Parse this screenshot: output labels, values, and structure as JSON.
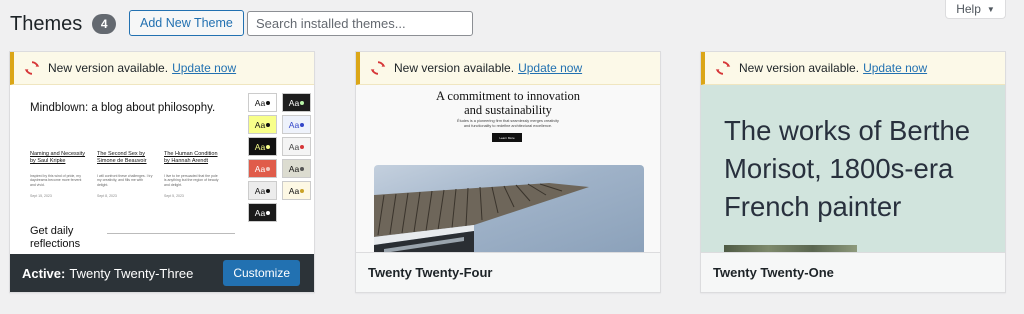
{
  "header": {
    "title": "Themes",
    "count": "4",
    "add_new_label": "Add New Theme",
    "search_placeholder": "Search installed themes...",
    "help_label": "Help",
    "help_caret": "▼"
  },
  "colors": {
    "accent": "#2271b1",
    "notice_border": "#dba617",
    "notice_bg": "#fcf9e8",
    "update_icon": "#d63638",
    "active_footer": "#2c3338"
  },
  "notice": {
    "icon": "update-icon",
    "text": "New version available.",
    "link": "Update now"
  },
  "themes": [
    {
      "name": "Twenty Twenty-Three",
      "active_prefix": "Active:",
      "customize_label": "Customize",
      "preview": {
        "blog_title": "Mindblown: a blog about philosophy.",
        "posts": [
          {
            "title": "Naming and Necessity by Saul Kripke",
            "excerpt": "Inspired by this wind of pride, my daydreams become more fervent and vivid.",
            "date": "Sept 15, 2023"
          },
          {
            "title": "The Second Sex by Simone de Beauvoir",
            "excerpt": "I will confront these challenges. I try my creativity, and fills me with delight.",
            "date": "Sept 8, 2023"
          },
          {
            "title": "The Human Condition by Hannah Arendt",
            "excerpt": "I live to be persuaded that the pole is anything but the region of beauty and delight.",
            "date": "Sept 5, 2023"
          }
        ],
        "reflections": "Get daily reflections",
        "swatch_label": "Aa"
      }
    },
    {
      "name": "Twenty Twenty-Four",
      "preview": {
        "headline_1": "A commitment to innovation",
        "headline_2": "and sustainability",
        "sub_1": "Études is a pioneering firm that seamlessly merges creativity",
        "sub_2": "and functionality to redefine architectural excellence.",
        "button": "Learn More"
      }
    },
    {
      "name": "Twenty Twenty-One",
      "preview": {
        "headline": "The works of Berthe Morisot, 1800s-era French painter"
      }
    }
  ]
}
